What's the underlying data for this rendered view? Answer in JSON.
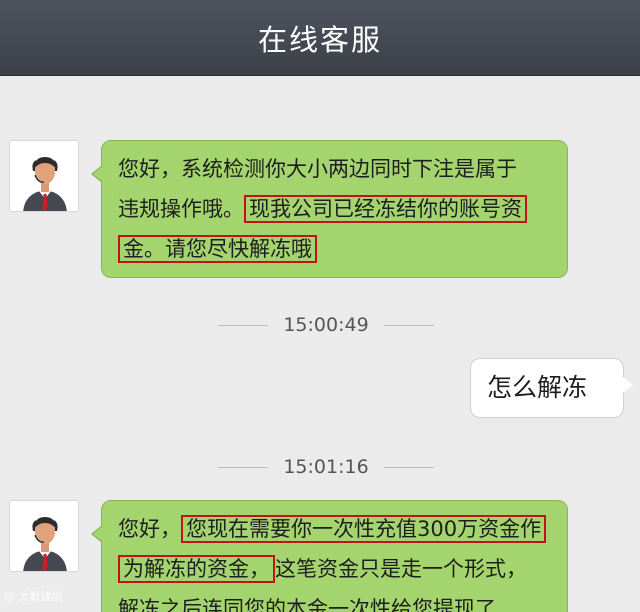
{
  "header": {
    "title": "在线客服"
  },
  "messages": [
    {
      "type": "incoming",
      "line1": "您好，系统检测你大小两边同时下注是属于",
      "line2_plain": "违规操作哦。",
      "line2_highlight": "现我公司已经冻结你的账号资",
      "line3_highlight": "金。请您尽快解冻哦"
    },
    {
      "type": "timestamp",
      "time": "15:00:49"
    },
    {
      "type": "outgoing",
      "text": "怎么解冻"
    },
    {
      "type": "timestamp",
      "time": "15:01:16"
    },
    {
      "type": "incoming",
      "line1_plain": "您好，",
      "line1_highlight": "您现在需要你一次性充值300万资金作",
      "line2_highlight": "为解冻的资金，",
      "line2_plain": "这笔资金只是走一个形式，",
      "line3_plain": "解冻之后连同您的本金一次性给您提现了"
    }
  ],
  "watermark": "@ 大數據說",
  "colors": {
    "titlebar": "#444a53",
    "incoming_bubble": "#a4d46e",
    "outgoing_bubble": "#ffffff",
    "highlight_border": "#c0141a",
    "background": "#ebebeb"
  },
  "icons": {
    "agent_avatar": "customer-service-agent-avatar-icon"
  }
}
